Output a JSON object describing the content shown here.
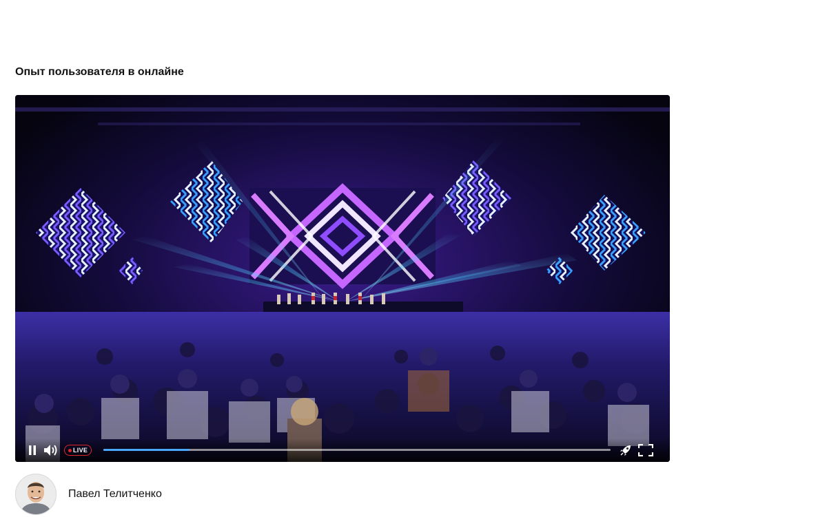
{
  "section": {
    "title": "Опыт пользователя в онлайне"
  },
  "player": {
    "state": "playing",
    "live_label": "LIVE",
    "progress": 0.17,
    "icons": {
      "pause": "pause-icon",
      "volume": "volume-icon",
      "rocket": "rocket-icon",
      "fullscreen": "fullscreen-icon"
    },
    "colors": {
      "live": "#e0262b",
      "progress": "#4aa8ff",
      "track": "rgba(255,255,255,0.55)"
    }
  },
  "author": {
    "name": "Павел Телитченко"
  }
}
